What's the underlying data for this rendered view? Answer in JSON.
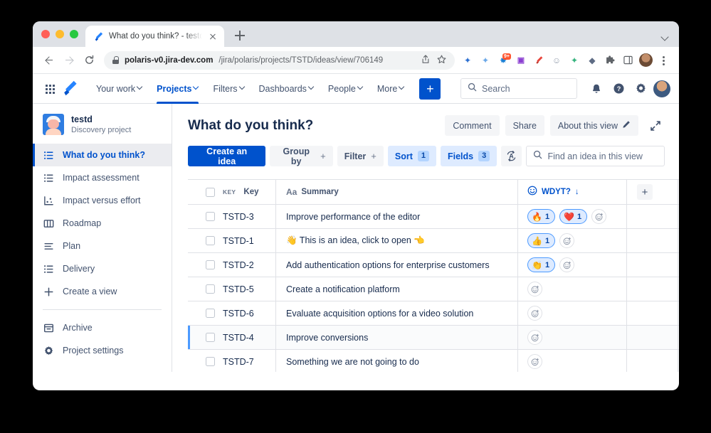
{
  "browser": {
    "tab": {
      "title": "What do you think? - testd - Jira",
      "favicon": "jira-icon",
      "close_icon": "close-icon"
    },
    "new_tab_icon": "new-tab-icon",
    "tab_list_icon": "chevron-down-icon",
    "back_icon": "back-arrow-icon",
    "forward_icon": "forward-arrow-icon",
    "reload_icon": "reload-icon",
    "url": {
      "lock_icon": "lock-icon",
      "host": "polaris-v0.jira-dev.com",
      "path": "/jira/polaris/projects/TSTD/ideas/view/706149",
      "share_icon": "share-icon",
      "bookmark_icon": "star-icon"
    },
    "extensions": [
      {
        "name": "sparkle-blue-icon",
        "glyph": "✦",
        "color": "#2c6fd1"
      },
      {
        "name": "sparkle-light-icon",
        "glyph": "✦",
        "color": "#6ba8e8"
      },
      {
        "name": "burst-icon",
        "glyph": "✸",
        "color": "#1b7fd4",
        "badge": "9+"
      },
      {
        "name": "bitwarden-icon",
        "glyph": "B",
        "color": "#8b3fd1"
      },
      {
        "name": "jira-extension-icon",
        "glyph": "◤",
        "color": "#e8453c"
      },
      {
        "name": "emoji-face-icon",
        "glyph": "☺",
        "color": "#97a0af"
      },
      {
        "name": "sparkle-green-icon",
        "glyph": "✦",
        "color": "#36b37e"
      },
      {
        "name": "box-icon",
        "glyph": "◆",
        "color": "#5e6c84"
      },
      {
        "name": "puzzle-icon",
        "glyph": "🧩",
        "color": "#5f6368"
      },
      {
        "name": "sidepanel-icon",
        "glyph": "▢",
        "color": "#5f6368"
      }
    ],
    "profile_icon": "profile-avatar",
    "menu_icon": "kebab-menu-icon"
  },
  "jira_nav": {
    "app_switcher_icon": "app-switcher-icon",
    "logo_icon": "jira-logo-icon",
    "links": [
      {
        "label": "Your work",
        "has_chevron": true,
        "active": false
      },
      {
        "label": "Projects",
        "has_chevron": true,
        "active": true
      },
      {
        "label": "Filters",
        "has_chevron": true,
        "active": false
      },
      {
        "label": "Dashboards",
        "has_chevron": true,
        "active": false
      },
      {
        "label": "People",
        "has_chevron": true,
        "active": false
      },
      {
        "label": "More",
        "has_chevron": true,
        "active": false
      }
    ],
    "create_button": {
      "label": "+",
      "name": "create-button",
      "color": "#0052cc"
    },
    "search": {
      "placeholder": "Search",
      "icon": "search-icon"
    },
    "icons": [
      {
        "name": "notifications-icon",
        "glyph": "🔔"
      },
      {
        "name": "help-icon",
        "glyph": "?"
      },
      {
        "name": "settings-icon",
        "glyph": "⚙"
      }
    ],
    "profile_icon": "user-avatar"
  },
  "sidebar": {
    "project": {
      "name": "testd",
      "type": "Discovery project",
      "avatar": "project-avatar"
    },
    "items": [
      {
        "label": "What do you think?",
        "icon": "list-view-icon",
        "active": true
      },
      {
        "label": "Impact assessment",
        "icon": "list-view-icon",
        "active": false
      },
      {
        "label": "Impact versus effort",
        "icon": "matrix-view-icon",
        "active": false
      },
      {
        "label": "Roadmap",
        "icon": "board-view-icon",
        "active": false
      },
      {
        "label": "Plan",
        "icon": "plan-icon",
        "active": false
      },
      {
        "label": "Delivery",
        "icon": "list-view-icon",
        "active": false
      },
      {
        "label": "Create a view",
        "icon": "plus-icon",
        "active": false
      }
    ],
    "footer_items": [
      {
        "label": "Archive",
        "icon": "archive-icon"
      },
      {
        "label": "Project settings",
        "icon": "gear-icon"
      }
    ]
  },
  "main": {
    "title": "What do you think?",
    "header_buttons": [
      {
        "label": "Comment",
        "name": "comment-button",
        "icon": null
      },
      {
        "label": "Share",
        "name": "share-button",
        "icon": null
      },
      {
        "label": "About this view",
        "name": "about-this-view-button",
        "icon": "pencil-icon"
      }
    ],
    "expand_icon": "expand-icon",
    "toolbar": {
      "create_idea": "Create an idea",
      "group_by": {
        "label": "Group by",
        "affordance": "+"
      },
      "filter": {
        "label": "Filter",
        "affordance": "+"
      },
      "sort": {
        "label": "Sort",
        "count": "1"
      },
      "fields": {
        "label": "Fields",
        "count": "3"
      },
      "autosort_icon": "auto-sort-icon",
      "find": {
        "placeholder": "Find an idea in this view",
        "icon": "search-icon"
      }
    },
    "table": {
      "columns": [
        {
          "key": "key",
          "label": "Key",
          "prefix": "KEY",
          "sorted": false
        },
        {
          "key": "summary",
          "label": "Summary",
          "prefix": "Aa",
          "sorted": false
        },
        {
          "key": "wdyt",
          "label": "WDYT?",
          "prefix": "emoji-icon",
          "sorted": true,
          "sort_dir": "↓"
        }
      ],
      "add_column_label": "+",
      "rows": [
        {
          "key": "TSTD-3",
          "summary": "Improve performance of the editor",
          "reactions": [
            {
              "emoji": "🔥",
              "count": "1"
            },
            {
              "emoji": "❤️",
              "count": "1"
            }
          ],
          "hovered": false
        },
        {
          "key": "TSTD-1",
          "summary": "👋 This is an idea, click to open 👈",
          "reactions": [
            {
              "emoji": "👍",
              "count": "1"
            }
          ],
          "hovered": false
        },
        {
          "key": "TSTD-2",
          "summary": "Add authentication options for enterprise customers",
          "reactions": [
            {
              "emoji": "👏",
              "count": "1"
            }
          ],
          "hovered": false
        },
        {
          "key": "TSTD-5",
          "summary": "Create a notification platform",
          "reactions": [],
          "hovered": false
        },
        {
          "key": "TSTD-6",
          "summary": "Evaluate acquisition options for a video solution",
          "reactions": [],
          "hovered": false
        },
        {
          "key": "TSTD-4",
          "summary": "Improve conversions",
          "reactions": [],
          "hovered": true
        },
        {
          "key": "TSTD-7",
          "summary": "Something we are not going to do",
          "reactions": [],
          "hovered": false
        }
      ],
      "add_reaction_icon": "add-reaction-icon"
    }
  },
  "colors": {
    "brand_blue": "#0052cc",
    "accent_blue": "#4c9aff",
    "chip_bg": "#deebff",
    "text_dark": "#172b4d",
    "text_muted": "#6b778c"
  }
}
